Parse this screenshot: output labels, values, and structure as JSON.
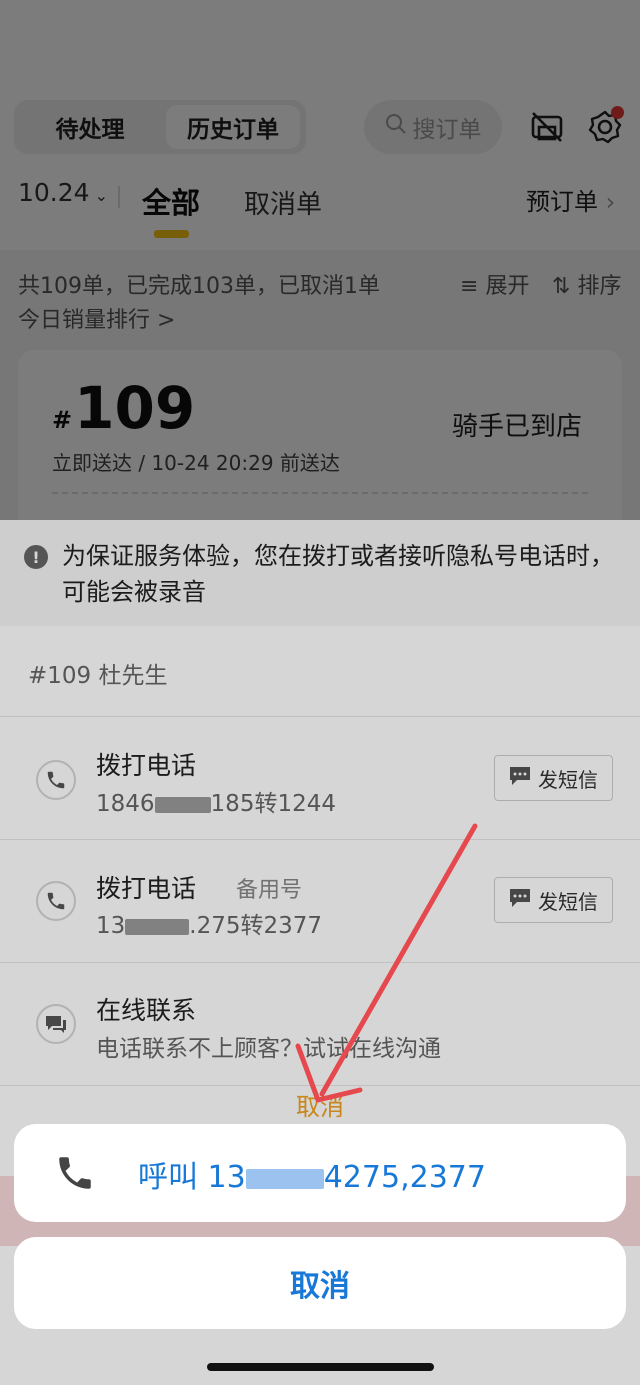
{
  "header": {
    "tabs": [
      "待处理",
      "历史订单"
    ],
    "active_tab": "历史订单",
    "search_placeholder": "搜订单",
    "icons": [
      "no-print-icon",
      "gear-icon"
    ]
  },
  "filter_bar": {
    "date": "10.24",
    "tabs": [
      "全部",
      "取消单"
    ],
    "active_tab": "全部",
    "reserve_label": "预订单"
  },
  "summary": {
    "text": "共109单，已完成103单，已取消1单",
    "expand_label": "展开",
    "sort_label": "排序",
    "ranking_link": "今日销量排行 >"
  },
  "order_card": {
    "hash": "#",
    "number": "109",
    "status": "骑手已到店",
    "delivery": "立即送达 / 10-24 20:29 前送达"
  },
  "contact_sheet": {
    "notice": "为保证服务体验，您在拨打或者接听隐私号电话时，可能会被录音",
    "customer": "#109 杜先生",
    "rows": [
      {
        "title": "拨打电话",
        "tag": "",
        "number_prefix": "1846",
        "number_suffix": "185转1244",
        "sms_label": "发短信"
      },
      {
        "title": "拨打电话",
        "tag": "备用号",
        "number_prefix": "13",
        "number_suffix": ".275转2377",
        "sms_label": "发短信"
      },
      {
        "title": "在线联系",
        "subtitle": "电话联系不上顾客？试试在线沟通"
      }
    ],
    "cancel_label": "取消"
  },
  "action_sheet": {
    "call_prefix": "呼叫 13",
    "call_suffix": "4275,2377",
    "cancel_label": "取消",
    "accent": "#1878d8"
  },
  "colors": {
    "tab_indicator": "#f5c518",
    "annotation_arrow": "#e5484d",
    "badge_red": "#e53935"
  }
}
